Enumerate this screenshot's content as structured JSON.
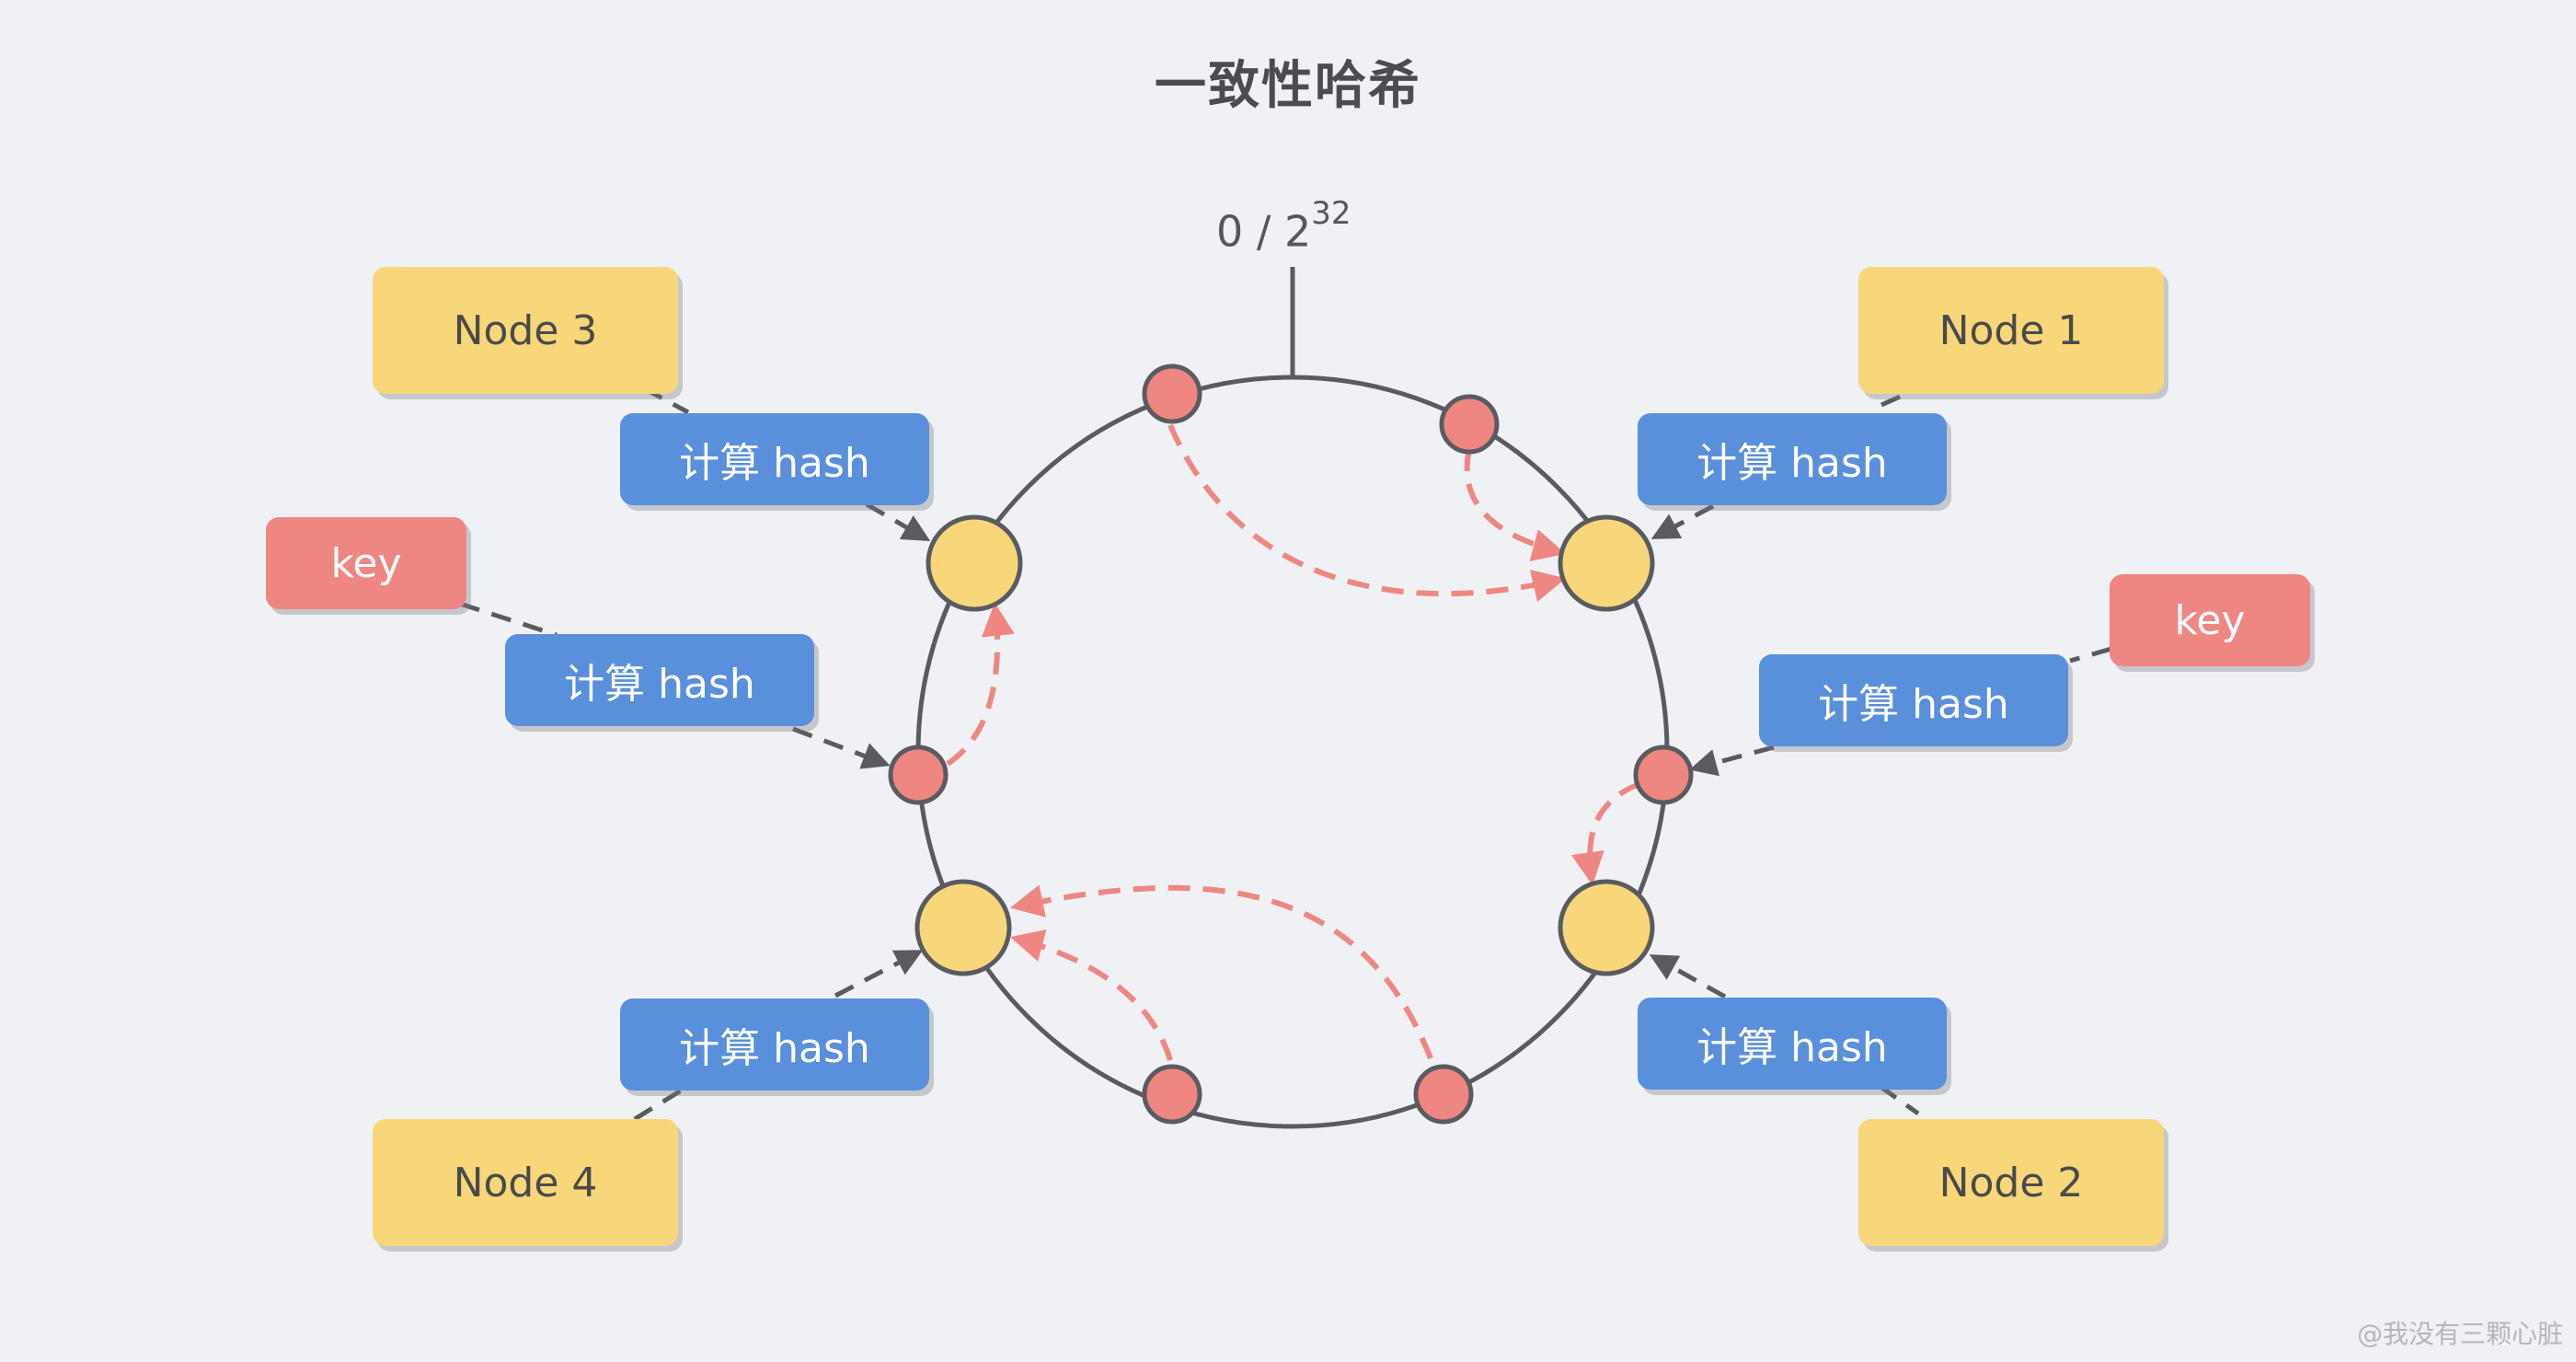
{
  "title": "一致性哈希",
  "ring_origin": {
    "base": "0 / 2",
    "exponent": "32"
  },
  "nodes": [
    "Node 1",
    "Node 2",
    "Node 3",
    "Node 4"
  ],
  "hash_label": "计算 hash",
  "key_label": "key",
  "watermark": "@我没有三颗心脏",
  "colors": {
    "background": "#f0f1f4",
    "node": "#f7d77a",
    "hash": "#5a8fdb",
    "key": "#ee8682",
    "ring": "#5a5b61",
    "arrow": "#ee8682",
    "connector": "#5a5b61"
  }
}
